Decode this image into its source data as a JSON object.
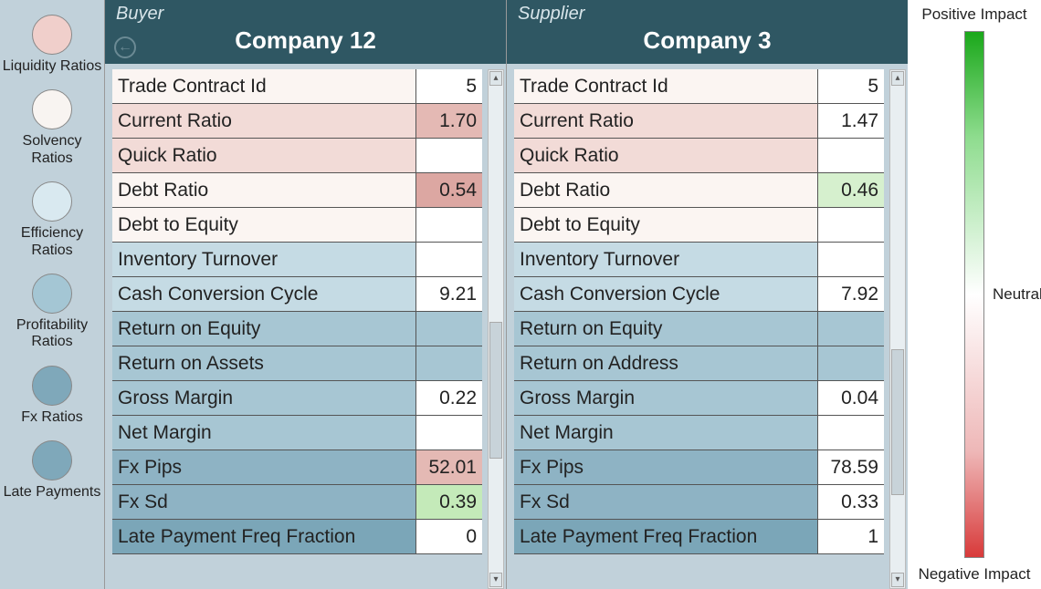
{
  "sidebar": {
    "items": [
      {
        "label": "Liquidity Ratios",
        "color": "#f0cfcb"
      },
      {
        "label": "Solvency Ratios",
        "color": "#f8f4f1"
      },
      {
        "label": "Efficiency Ratios",
        "color": "#d9e9f0"
      },
      {
        "label": "Profitability Ratios",
        "color": "#a4c6d4"
      },
      {
        "label": "Fx Ratios",
        "color": "#7fa8ba"
      },
      {
        "label": "Late Payments",
        "color": "#7fa8ba"
      }
    ]
  },
  "legend": {
    "top": "Positive Impact",
    "mid": "Neutral",
    "bottom": "Negative Impact"
  },
  "buyer": {
    "role": "Buyer",
    "company": "Company 12",
    "rows": [
      {
        "label": "Trade Contract Id",
        "value": "5",
        "labelBg": "bg-offw",
        "valueBg": "bg-white"
      },
      {
        "label": "Current Ratio",
        "value": "1.70",
        "labelBg": "bg-pink1",
        "valueBg": "bg-pink2"
      },
      {
        "label": "Quick Ratio",
        "value": "",
        "labelBg": "bg-pink1",
        "valueBg": "bg-white"
      },
      {
        "label": "Debt Ratio",
        "value": "0.54",
        "labelBg": "bg-offw",
        "valueBg": "bg-pink3"
      },
      {
        "label": "Debt to Equity",
        "value": "",
        "labelBg": "bg-offw",
        "valueBg": "bg-white"
      },
      {
        "label": "Inventory Turnover",
        "value": "",
        "labelBg": "bg-blue2",
        "valueBg": "bg-white"
      },
      {
        "label": "Cash Conversion Cycle",
        "value": "9.21",
        "labelBg": "bg-blue2",
        "valueBg": "bg-white"
      },
      {
        "label": "Return on Equity",
        "value": "",
        "labelBg": "bg-blue3",
        "valueBg": "bg-blue3"
      },
      {
        "label": "Return on Assets",
        "value": "",
        "labelBg": "bg-blue3",
        "valueBg": "bg-blue3"
      },
      {
        "label": "Gross Margin",
        "value": "0.22",
        "labelBg": "bg-blue3",
        "valueBg": "bg-white"
      },
      {
        "label": "Net Margin",
        "value": "",
        "labelBg": "bg-blue3",
        "valueBg": "bg-white"
      },
      {
        "label": "Fx Pips",
        "value": "52.01",
        "labelBg": "bg-blue4",
        "valueBg": "bg-pink2"
      },
      {
        "label": "Fx Sd",
        "value": "0.39",
        "labelBg": "bg-blue4",
        "valueBg": "bg-green2"
      },
      {
        "label": "Late Payment Freq Fraction",
        "value": "0",
        "labelBg": "bg-blue5",
        "valueBg": "bg-white"
      }
    ]
  },
  "supplier": {
    "role": "Supplier",
    "company": "Company 3",
    "rows": [
      {
        "label": "Trade Contract Id",
        "value": "5",
        "labelBg": "bg-offw",
        "valueBg": "bg-white"
      },
      {
        "label": "Current Ratio",
        "value": "1.47",
        "labelBg": "bg-pink1",
        "valueBg": "bg-white"
      },
      {
        "label": "Quick Ratio",
        "value": "",
        "labelBg": "bg-pink1",
        "valueBg": "bg-white"
      },
      {
        "label": "Debt Ratio",
        "value": "0.46",
        "labelBg": "bg-offw",
        "valueBg": "bg-green1"
      },
      {
        "label": "Debt to Equity",
        "value": "",
        "labelBg": "bg-offw",
        "valueBg": "bg-white"
      },
      {
        "label": "Inventory Turnover",
        "value": "",
        "labelBg": "bg-blue2",
        "valueBg": "bg-white"
      },
      {
        "label": "Cash Conversion Cycle",
        "value": "7.92",
        "labelBg": "bg-blue2",
        "valueBg": "bg-white"
      },
      {
        "label": "Return on Equity",
        "value": "",
        "labelBg": "bg-blue3",
        "valueBg": "bg-blue3"
      },
      {
        "label": "Return on Address",
        "value": "",
        "labelBg": "bg-blue3",
        "valueBg": "bg-blue3"
      },
      {
        "label": "Gross Margin",
        "value": "0.04",
        "labelBg": "bg-blue3",
        "valueBg": "bg-white"
      },
      {
        "label": "Net Margin",
        "value": "",
        "labelBg": "bg-blue3",
        "valueBg": "bg-white"
      },
      {
        "label": "Fx Pips",
        "value": "78.59",
        "labelBg": "bg-blue4",
        "valueBg": "bg-white"
      },
      {
        "label": "Fx Sd",
        "value": "0.33",
        "labelBg": "bg-blue4",
        "valueBg": "bg-white"
      },
      {
        "label": "Late Payment Freq Fraction",
        "value": "1",
        "labelBg": "bg-blue5",
        "valueBg": "bg-white"
      }
    ]
  }
}
